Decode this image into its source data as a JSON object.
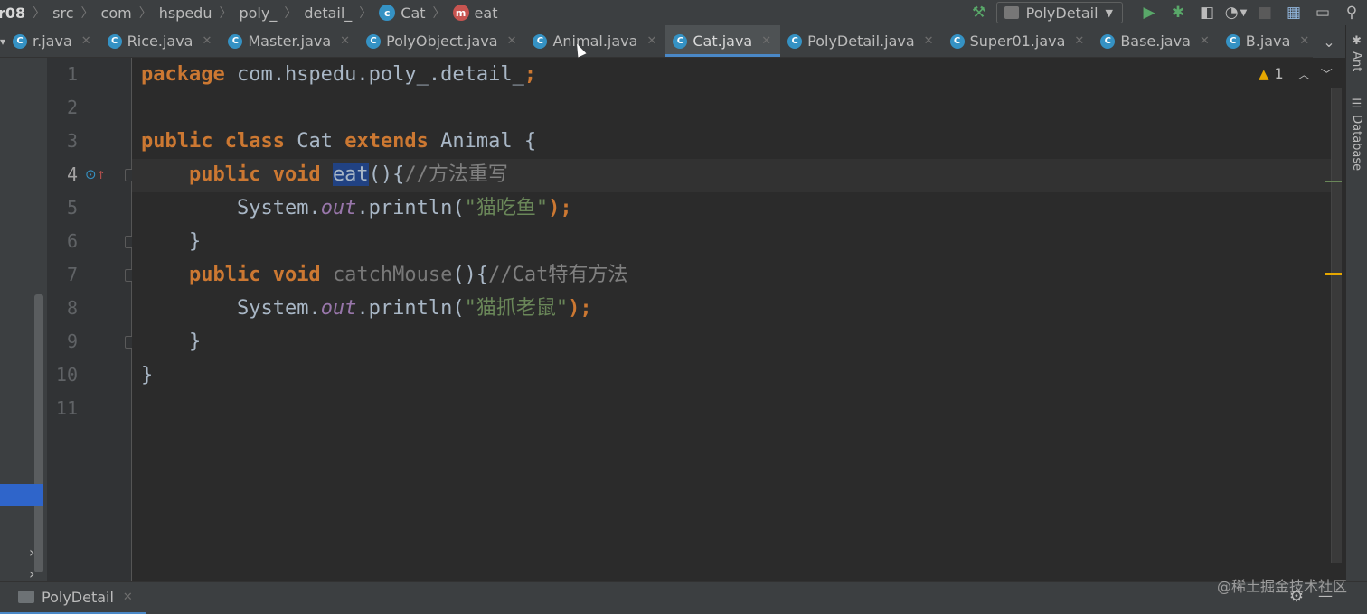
{
  "breadcrumbs": {
    "project": "r08",
    "items": [
      "src",
      "com",
      "hspedu",
      "poly_",
      "detail_"
    ],
    "class_name": "Cat",
    "method_name": "eat",
    "class_icon": "c",
    "method_icon": "m"
  },
  "toolbar": {
    "run_config": "PolyDetail",
    "icons": [
      "hammer-icon",
      "run-icon",
      "debug-icon",
      "coverage-icon",
      "profiler-icon",
      "stop-icon",
      "project-structure-icon",
      "layout-icon",
      "search-icon"
    ]
  },
  "tabs": [
    {
      "label": "r.java",
      "icon": "C",
      "active": false
    },
    {
      "label": "Rice.java",
      "icon": "C",
      "active": false
    },
    {
      "label": "Master.java",
      "icon": "C",
      "active": false
    },
    {
      "label": "PolyObject.java",
      "icon": "C",
      "active": false
    },
    {
      "label": "Animal.java",
      "icon": "C",
      "active": false
    },
    {
      "label": "Cat.java",
      "icon": "C",
      "active": true
    },
    {
      "label": "PolyDetail.java",
      "icon": "C",
      "active": false
    },
    {
      "label": "Super01.java",
      "icon": "C",
      "active": false
    },
    {
      "label": "Base.java",
      "icon": "C",
      "active": false
    },
    {
      "label": "B.java",
      "icon": "C",
      "active": false
    }
  ],
  "side_panels": {
    "right": [
      "Ant",
      "Database"
    ]
  },
  "editor": {
    "line_numbers": [
      "1",
      "2",
      "3",
      "4",
      "5",
      "6",
      "7",
      "8",
      "9",
      "10",
      "11"
    ],
    "current_line": "4",
    "warnings": "1",
    "code": {
      "l1_kw": "package",
      "l1_rest": " com.hspedu.poly_.detail_",
      "l1_semi": ";",
      "l3_kw1": "public",
      "l3_kw2": "class",
      "l3_name": " Cat ",
      "l3_kw3": "extends",
      "l3_rest": " Animal {",
      "l4_kw": "public void",
      "l4_method": "eat",
      "l4_paren": "(){",
      "l4_comment": "//方法重写",
      "l5_sys": "System.",
      "l5_out": "out",
      "l5_call": ".println(",
      "l5_str": "\"猫吃鱼\"",
      "l5_end": ");",
      "l6": "}",
      "l7_kw": "public void",
      "l7_method": "catchMouse",
      "l7_paren": "(){",
      "l7_comment": "//Cat特有方法",
      "l8_sys": "System.",
      "l8_out": "out",
      "l8_call": ".println(",
      "l8_str": "\"猫抓老鼠\"",
      "l8_end": ");",
      "l9": "}",
      "l10": "}"
    }
  },
  "bottom": {
    "run_tab": "PolyDetail",
    "watermark": "@稀土掘金技术社区"
  },
  "colors": {
    "keyword": "#cc7832",
    "string": "#6a8759",
    "comment": "#808080",
    "field": "#9876aa",
    "accent": "#4a88c7"
  }
}
